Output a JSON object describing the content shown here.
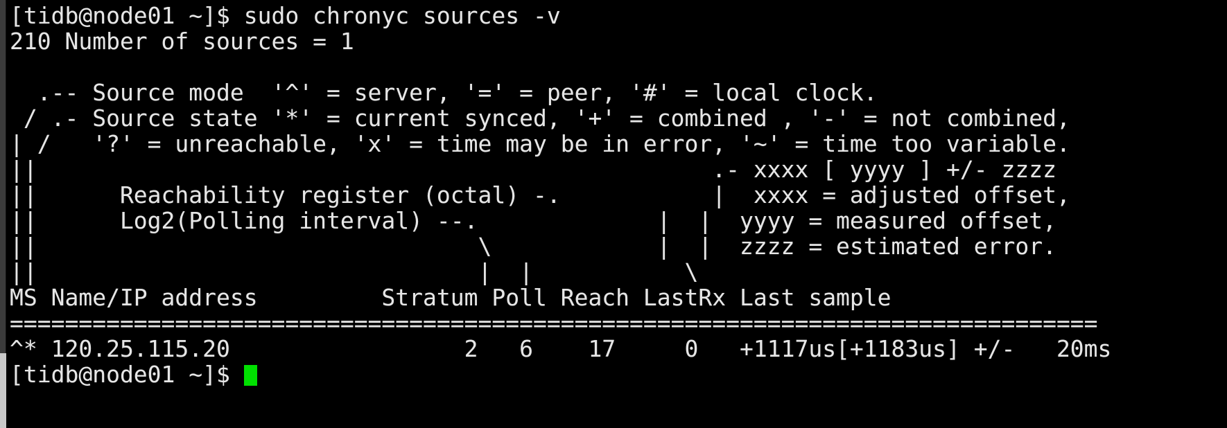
{
  "terminal": {
    "background_color": "#000000",
    "foreground_color": "#e6e6e6",
    "cursor_color": "#00e000",
    "gutter_color": "#3b3b3b",
    "prompt": "[tidb@node01 ~]$",
    "command": "sudo chronyc sources -v",
    "command_line": "[tidb@node01 ~]$ sudo chronyc sources -v",
    "response_code_line": "210 Number of sources = 1",
    "trailing_prompt": "[tidb@node01 ~]$"
  },
  "legend": {
    "blank_1": "",
    "source_mode_line": "  .-- Source mode  '^' = server, '=' = peer, '#' = local clock.",
    "source_state_line": " / .- Source state '*' = current synced, '+' = combined , '-' = not combined,",
    "unreachable_line": "| /   '?' = unreachable, 'x' = time may be in error, '~' = time too variable.",
    "xyz_header_line": "||                                                 .- xxxx [ yyyy ] +/- zzzz",
    "reach_register_line": "||      Reachability register (octal) -.           |  xxxx = adjusted offset,",
    "log2_poll_line": "||      Log2(Polling interval) --.             |  |  yyyy = measured offset,",
    "connector_line_1": "||                                \\            |  |  zzzz = estimated error.",
    "connector_line_2": "||                                |  |           \\"
  },
  "table": {
    "header_line": "MS Name/IP address         Stratum Poll Reach LastRx Last sample",
    "separator_line": "===============================================================================",
    "columns": [
      "MS",
      "Name/IP address",
      "Stratum",
      "Poll",
      "Reach",
      "LastRx",
      "Last sample"
    ],
    "rows": [
      {
        "line": "^* 120.25.115.20                 2   6    17     0   +1117us[+1183us] +/-   20ms",
        "ms": "^*",
        "name_ip": "120.25.115.20",
        "stratum": "2",
        "poll": "6",
        "reach": "17",
        "lastrx": "0",
        "last_sample": "+1117us[+1183us] +/-   20ms",
        "adjusted_offset": "+1117us",
        "measured_offset": "+1183us",
        "estimated_error": "20ms"
      }
    ]
  },
  "legend_meanings": {
    "source_mode": {
      "caret": "server",
      "equals": "peer",
      "hash": "local clock"
    },
    "source_state": {
      "asterisk": "current synced",
      "plus": "combined",
      "minus": "not combined",
      "question": "unreachable",
      "x": "time may be in error",
      "tilde": "time too variable"
    },
    "sample_fields": {
      "xxxx": "adjusted offset",
      "yyyy": "measured offset",
      "zzzz": "estimated error"
    }
  }
}
